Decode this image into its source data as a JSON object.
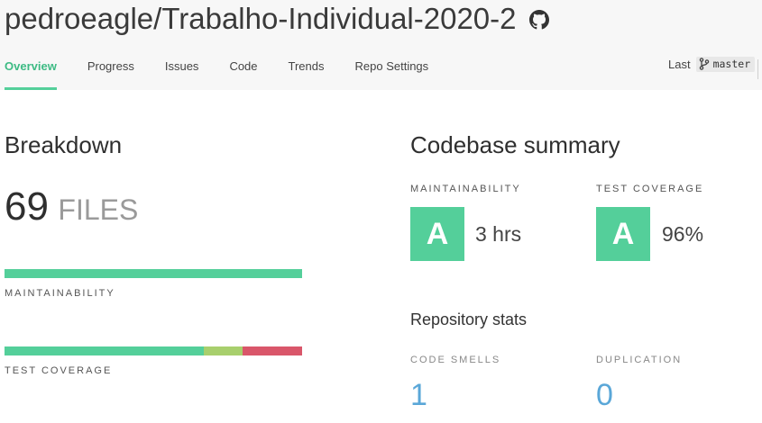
{
  "repo": {
    "title": "pedroeagle/Trabalho-Individual-2020-2",
    "icon": "github-icon"
  },
  "tabs": [
    {
      "label": "Overview",
      "active": true
    },
    {
      "label": "Progress"
    },
    {
      "label": "Issues"
    },
    {
      "label": "Code"
    },
    {
      "label": "Trends"
    },
    {
      "label": "Repo Settings"
    }
  ],
  "last": {
    "label": "Last",
    "branch_icon": "git-branch-icon",
    "branch": "master"
  },
  "breakdown": {
    "title": "Breakdown",
    "files_count": "69",
    "files_unit": "FILES",
    "maintainability_label": "MAINTAINABILITY",
    "maintainability_bar": [
      {
        "fraction": 1.0,
        "color": "#54cf9a"
      }
    ],
    "coverage_label": "TEST COVERAGE",
    "coverage_bar": [
      {
        "fraction": 0.67,
        "color": "#54cf9a"
      },
      {
        "fraction": 0.13,
        "color": "#a8cf6d"
      },
      {
        "fraction": 0.2,
        "color": "#d9566a"
      }
    ]
  },
  "summary": {
    "title": "Codebase summary",
    "maintainability": {
      "label": "MAINTAINABILITY",
      "grade": "A",
      "value": "3 hrs"
    },
    "coverage": {
      "label": "TEST COVERAGE",
      "grade": "A",
      "value": "96%"
    }
  },
  "stats": {
    "title": "Repository stats",
    "code_smells": {
      "label": "CODE SMELLS",
      "value": "1"
    },
    "duplication": {
      "label": "DUPLICATION",
      "value": "0"
    }
  },
  "colors": {
    "accent": "#54cf9a",
    "link": "#5aa7d8"
  }
}
